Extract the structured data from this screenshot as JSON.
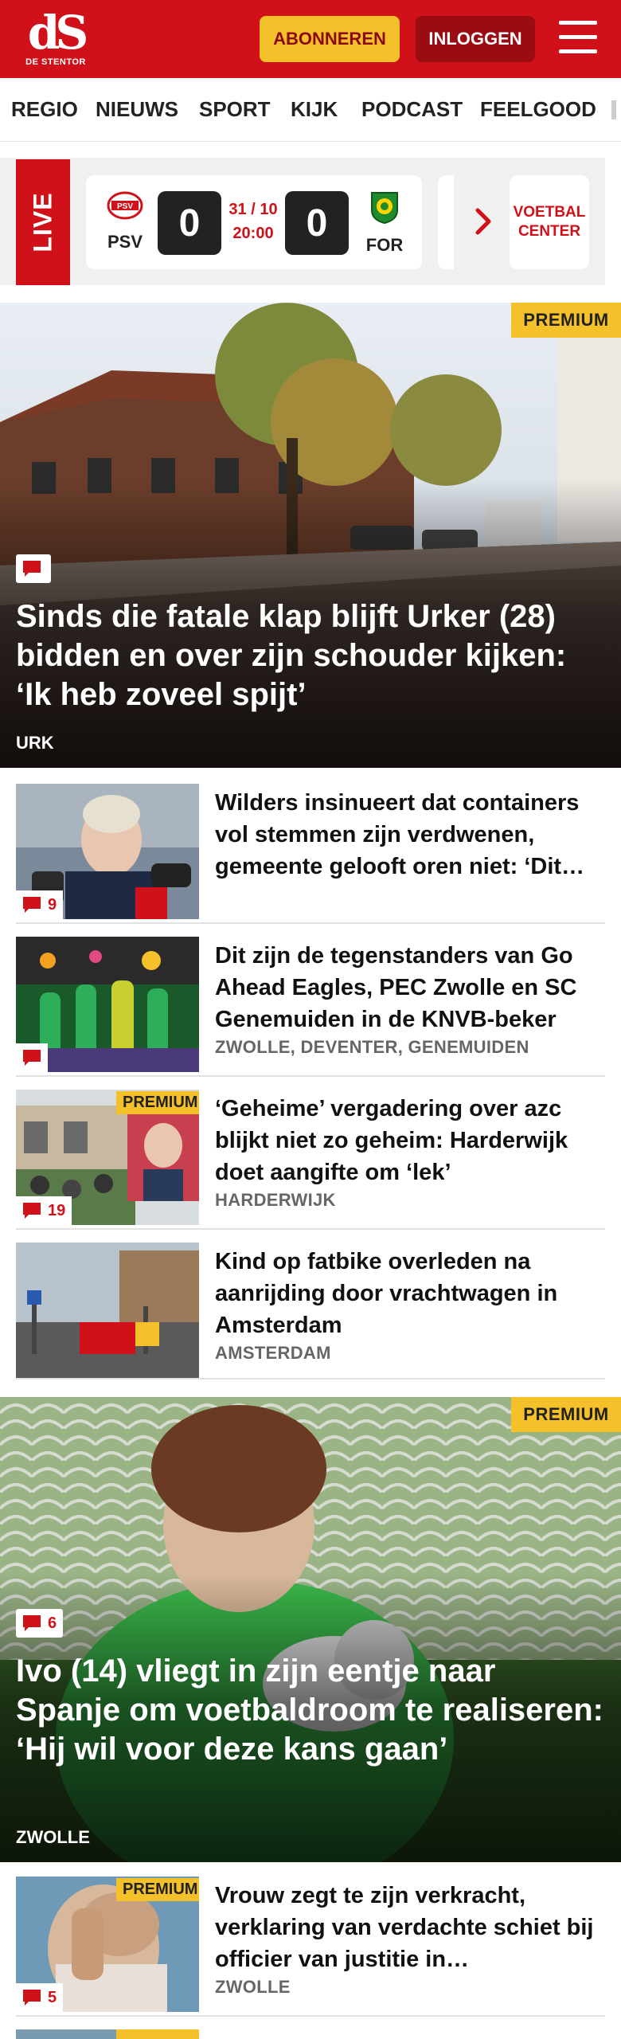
{
  "header": {
    "logo_mark": "dS",
    "logo_text": "DE STENTOR",
    "subscribe_label": "ABONNEREN",
    "login_label": "INLOGGEN",
    "brand_color": "#d0111a",
    "accent_color": "#f4c12a"
  },
  "nav": {
    "items": [
      "REGIO",
      "NIEUWS",
      "SPORT",
      "KIJK",
      "PODCAST",
      "FEELGOOD"
    ]
  },
  "live": {
    "label": "LIVE",
    "match": {
      "home_abbr": "PSV",
      "away_abbr": "FOR",
      "home_score": "0",
      "away_score": "0",
      "date": "31 / 10",
      "time": "20:00",
      "home_logo_text": "PSV"
    },
    "voetbal_center": "VOETBAL CENTER"
  },
  "hero1": {
    "premium": "PREMIUM",
    "title": "Sinds die fatale klap blijft Urker (28) bidden en over zijn schouder kijken: ‘Ik heb zoveel spijt’",
    "location": "URK"
  },
  "articles": [
    {
      "title": "Wilders insinueert dat containers vol stemmen zijn verdwenen, gemeente gelooft oren niet: ‘Dit…",
      "location": "",
      "comments": "9",
      "premium": ""
    },
    {
      "title": "Dit zijn de tegenstanders van Go Ahead Eagles, PEC Zwolle en SC Genemuiden in de KNVB-beker",
      "location": "ZWOLLE, DEVENTER, GENEMUIDEN",
      "comments": "",
      "premium": ""
    },
    {
      "title": "‘Geheime’ vergadering over azc blijkt niet zo geheim: Harderwijk doet aangifte om ‘lek’",
      "location": "HARDERWIJK",
      "comments": "19",
      "premium": "PREMIUM"
    },
    {
      "title": "Kind op fatbike overleden na aanrijding door vrachtwagen in Amsterdam",
      "location": "AMSTERDAM",
      "comments": "",
      "premium": ""
    }
  ],
  "hero2": {
    "premium": "PREMIUM",
    "title": "Ivo (14) vliegt in zijn eentje naar Spanje om voetbaldroom te realiseren: ‘Hij wil voor deze kans gaan’",
    "location": "ZWOLLE",
    "comments": "6"
  },
  "articles2": [
    {
      "title": "Vrouw zegt te zijn verkracht, verklaring van verdachte schiet bij officier van justitie in…",
      "location": "ZWOLLE",
      "comments": "5",
      "premium": "PREMIUM"
    }
  ],
  "icons": {
    "menu": "hamburger-menu-icon",
    "comment": "speech-bubble-icon",
    "next": "chevron-right-icon"
  }
}
